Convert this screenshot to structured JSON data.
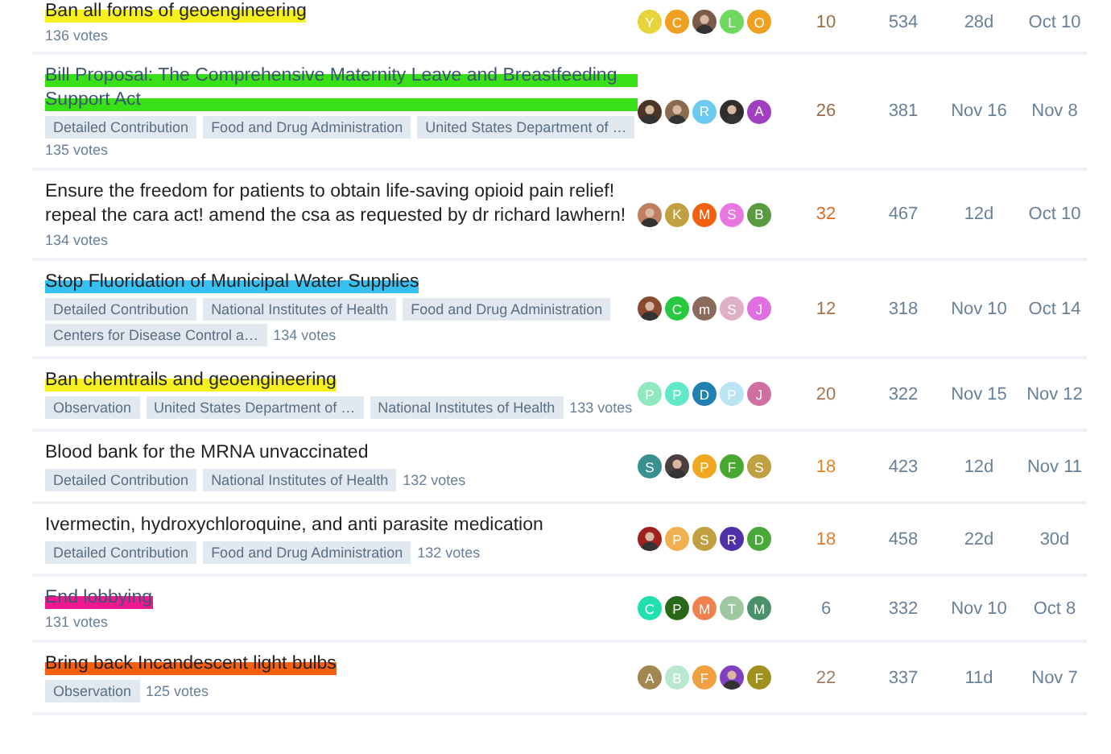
{
  "topics": [
    {
      "title": "Ban all forms of geoengineering",
      "marker": {
        "color": "#f5f01e"
      },
      "visited": false,
      "votes": "136 votes",
      "posters": [
        {
          "kind": "letter",
          "letter": "Y",
          "color": "#e9d33a"
        },
        {
          "kind": "letter",
          "letter": "C",
          "color": "#f0a020"
        },
        {
          "kind": "photo",
          "color": "#7a5a48"
        },
        {
          "kind": "letter",
          "letter": "L",
          "color": "#70d860"
        },
        {
          "kind": "letter",
          "letter": "O",
          "color": "#f0a020"
        }
      ],
      "replies": {
        "count": "10",
        "color": "#9c6f45"
      },
      "views": "534",
      "activity": "28d",
      "created": "Oct 10"
    },
    {
      "title": "Bill Proposal: The Comprehensive Maternity Leave and Breastfeeding Support Act",
      "marker": {
        "color": "#38e018"
      },
      "visited": true,
      "tags": [
        "Detailed Contribution",
        "Food and Drug Administration",
        "United States Department of …"
      ],
      "votes": "135 votes",
      "posters": [
        {
          "kind": "photo",
          "color": "#4a3428"
        },
        {
          "kind": "photo",
          "color": "#8a6a50"
        },
        {
          "kind": "letter",
          "letter": "R",
          "color": "#6ccaf0"
        },
        {
          "kind": "photo",
          "color": "#2e2e2e"
        },
        {
          "kind": "letter",
          "letter": "A",
          "color": "#a040c0"
        }
      ],
      "replies": {
        "count": "26",
        "color": "#9c6a48"
      },
      "views": "381",
      "activity": "Nov 16",
      "created": "Nov 8"
    },
    {
      "title": "Ensure the freedom for patients to obtain life-saving opioid pain relief! repeal the cara act! amend the csa as requested by dr richard lawhern!",
      "visited": false,
      "votes": "134 votes",
      "posters": [
        {
          "kind": "photo",
          "color": "#c08060"
        },
        {
          "kind": "letter",
          "letter": "K",
          "color": "#c0a040"
        },
        {
          "kind": "letter",
          "letter": "M",
          "color": "#f06010"
        },
        {
          "kind": "letter",
          "letter": "S",
          "color": "#e878e0"
        },
        {
          "kind": "letter",
          "letter": "B",
          "color": "#5a9a40"
        }
      ],
      "replies": {
        "count": "32",
        "color": "#e0681f"
      },
      "views": "467",
      "activity": "12d",
      "created": "Oct 10"
    },
    {
      "title": "Stop Fluoridation of Municipal Water Supplies",
      "marker": {
        "color": "#38c0f0"
      },
      "visited": false,
      "tags": [
        "Detailed Contribution",
        "National Institutes of Health",
        "Food and Drug Administration",
        "Centers for Disease Control a…"
      ],
      "votes": "134 votes",
      "posters": [
        {
          "kind": "photo",
          "color": "#8a4a30"
        },
        {
          "kind": "letter",
          "letter": "C",
          "color": "#28c840"
        },
        {
          "kind": "letter",
          "letter": "m",
          "color": "#8a6a5a"
        },
        {
          "kind": "letter",
          "letter": "S",
          "color": "#e0b0c8"
        },
        {
          "kind": "letter",
          "letter": "J",
          "color": "#e070e0"
        }
      ],
      "replies": {
        "count": "12",
        "color": "#a8714a"
      },
      "views": "318",
      "activity": "Nov 10",
      "created": "Oct 14"
    },
    {
      "title": "Ban chemtrails and geoengineering",
      "marker": {
        "color": "#f5f01e"
      },
      "visited": false,
      "tags": [
        "Observation",
        "United States Department of …",
        "National Institutes of Health"
      ],
      "votes": "133 votes",
      "posters": [
        {
          "kind": "letter",
          "letter": "P",
          "color": "#90e8c0"
        },
        {
          "kind": "letter",
          "letter": "P",
          "color": "#60e8c8"
        },
        {
          "kind": "letter",
          "letter": "D",
          "color": "#2080b0"
        },
        {
          "kind": "letter",
          "letter": "P",
          "color": "#b8e4f4"
        },
        {
          "kind": "letter",
          "letter": "J",
          "color": "#d070a0"
        }
      ],
      "replies": {
        "count": "20",
        "color": "#a47555"
      },
      "views": "322",
      "activity": "Nov 15",
      "created": "Nov 12"
    },
    {
      "title": "Blood bank for the MRNA unvaccinated",
      "visited": false,
      "tags": [
        "Detailed Contribution",
        "National Institutes of Health"
      ],
      "votes": "132 votes",
      "posters": [
        {
          "kind": "letter",
          "letter": "S",
          "color": "#3a9090"
        },
        {
          "kind": "photo",
          "color": "#4a4040"
        },
        {
          "kind": "letter",
          "letter": "P",
          "color": "#f0a820"
        },
        {
          "kind": "letter",
          "letter": "F",
          "color": "#48a830"
        },
        {
          "kind": "letter",
          "letter": "S",
          "color": "#c0a040"
        }
      ],
      "replies": {
        "count": "18",
        "color": "#e88322"
      },
      "views": "423",
      "activity": "12d",
      "created": "Nov 11"
    },
    {
      "title": "Ivermectin, hydroxychloroquine, and anti parasite medication",
      "visited": false,
      "tags": [
        "Detailed Contribution",
        "Food and Drug Administration"
      ],
      "votes": "132 votes",
      "posters": [
        {
          "kind": "photo",
          "color": "#a02020"
        },
        {
          "kind": "letter",
          "letter": "P",
          "color": "#f0b050"
        },
        {
          "kind": "letter",
          "letter": "S",
          "color": "#c0a040"
        },
        {
          "kind": "letter",
          "letter": "R",
          "color": "#5030a8"
        },
        {
          "kind": "letter",
          "letter": "D",
          "color": "#48a838"
        }
      ],
      "replies": {
        "count": "18",
        "color": "#e07a27"
      },
      "views": "458",
      "activity": "22d",
      "created": "30d"
    },
    {
      "title": "End lobbying",
      "marker": {
        "color": "#f01890"
      },
      "visited": true,
      "votes": "131 votes",
      "posters": [
        {
          "kind": "letter",
          "letter": "C",
          "color": "#20e0b0"
        },
        {
          "kind": "letter",
          "letter": "P",
          "color": "#286818"
        },
        {
          "kind": "letter",
          "letter": "M",
          "color": "#f08050"
        },
        {
          "kind": "letter",
          "letter": "T",
          "color": "#a0c8a0"
        },
        {
          "kind": "letter",
          "letter": "M",
          "color": "#4a9068"
        }
      ],
      "replies": {
        "count": "6",
        "color": "#6b7f93"
      },
      "views": "332",
      "activity": "Nov 10",
      "created": "Oct 8"
    },
    {
      "title": "Bring back Incandescent light bulbs",
      "marker": {
        "color": "#f86010"
      },
      "visited": false,
      "tags": [
        "Observation"
      ],
      "votes": "125 votes",
      "posters": [
        {
          "kind": "letter",
          "letter": "A",
          "color": "#a08850"
        },
        {
          "kind": "letter",
          "letter": "B",
          "color": "#b8e8d0"
        },
        {
          "kind": "letter",
          "letter": "F",
          "color": "#f0a040"
        },
        {
          "kind": "photo",
          "color": "#8040c0"
        },
        {
          "kind": "letter",
          "letter": "F",
          "color": "#a09020"
        }
      ],
      "replies": {
        "count": "22",
        "color": "#a07a5e"
      },
      "views": "337",
      "activity": "11d",
      "created": "Nov 7"
    }
  ]
}
